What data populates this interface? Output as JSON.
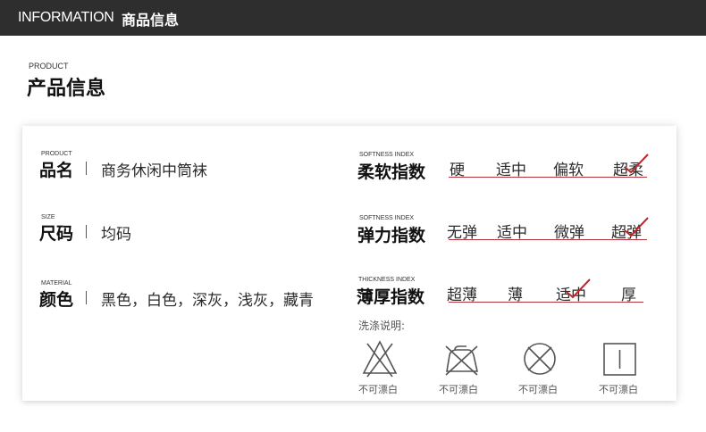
{
  "header": {
    "title_en": "INFORMATION",
    "title_zh": "商品信息"
  },
  "section": {
    "title_en": "PRODUCT",
    "title_zh": "产品信息"
  },
  "specs": [
    {
      "label_en": "PRODUCT",
      "label_zh": "品名",
      "value": "商务休闲中筒袜"
    },
    {
      "label_en": "SIZE",
      "label_zh": "尺码",
      "value": "均码"
    },
    {
      "label_en": "MATERIAL",
      "label_zh": "颜色",
      "value": "黑色，白色，深灰，浅灰，藏青"
    }
  ],
  "scales": [
    {
      "label_en": "SOFTNESS INDEX",
      "label_zh": "柔软指数",
      "options": [
        "硬",
        "适中",
        "偏软",
        "超柔"
      ],
      "selected": "超柔"
    },
    {
      "label_en": "SOFTNESS INDEX",
      "label_zh": "弹力指数",
      "options": [
        "无弹",
        "适中",
        "微弹",
        "超弹"
      ],
      "selected": "超弹"
    },
    {
      "label_en": "THICKNESS INDEX",
      "label_zh": "薄厚指数",
      "options": [
        "超薄",
        "薄",
        "适中",
        "厚"
      ],
      "selected": "适中"
    }
  ],
  "wash": {
    "label": "洗涤说明:",
    "items": [
      {
        "icon": "no-bleach-icon",
        "text": "不可漂白"
      },
      {
        "icon": "no-iron-icon",
        "text": "不可漂白"
      },
      {
        "icon": "no-tumble-dry-icon",
        "text": "不可漂白"
      },
      {
        "icon": "line-dry-icon",
        "text": "不可漂白"
      }
    ]
  },
  "colors": {
    "topbar": "#2e2e2e",
    "accent": "#b3343d",
    "check": "#c0272d"
  }
}
